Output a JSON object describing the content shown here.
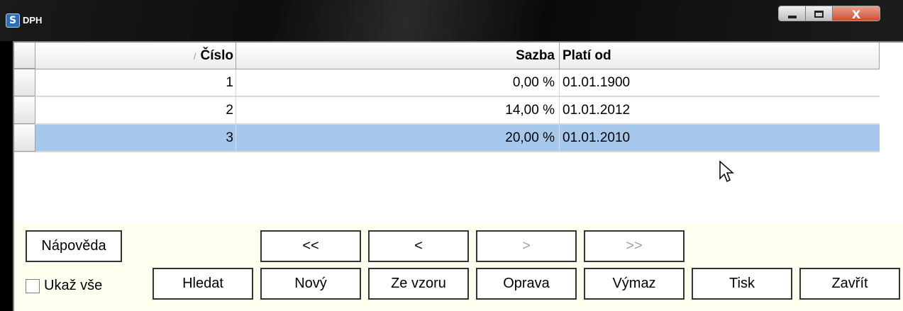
{
  "window": {
    "icon_glyph": "S",
    "title": "DPH",
    "controls": {
      "minimize": "minimize-icon",
      "maximize": "maximize-icon",
      "close": "X"
    }
  },
  "grid": {
    "columns": [
      {
        "label": "Číslo",
        "sort_indicator": "/"
      },
      {
        "label": "Sazba"
      },
      {
        "label": "Platí od"
      }
    ],
    "rows": [
      {
        "cislo": "1",
        "sazba": "0,00 %",
        "plati_od": "01.01.1900"
      },
      {
        "cislo": "2",
        "sazba": "14,00 %",
        "plati_od": "01.01.2012"
      },
      {
        "cislo": "3",
        "sazba": "20,00 %",
        "plati_od": "01.01.2010"
      }
    ],
    "selected_row": 3,
    "selection_color": "#a6c8ec"
  },
  "toolbar": {
    "help": "Nápověda",
    "first": "<<",
    "prev": "<",
    "next": ">",
    "last": ">>",
    "show_all": "Ukaž vše",
    "show_all_checked": false,
    "search": "Hledat",
    "new": "Nový",
    "from_template": "Ze vzoru",
    "edit": "Oprava",
    "delete": "Výmaz",
    "print": "Tisk",
    "close": "Zavřít"
  }
}
